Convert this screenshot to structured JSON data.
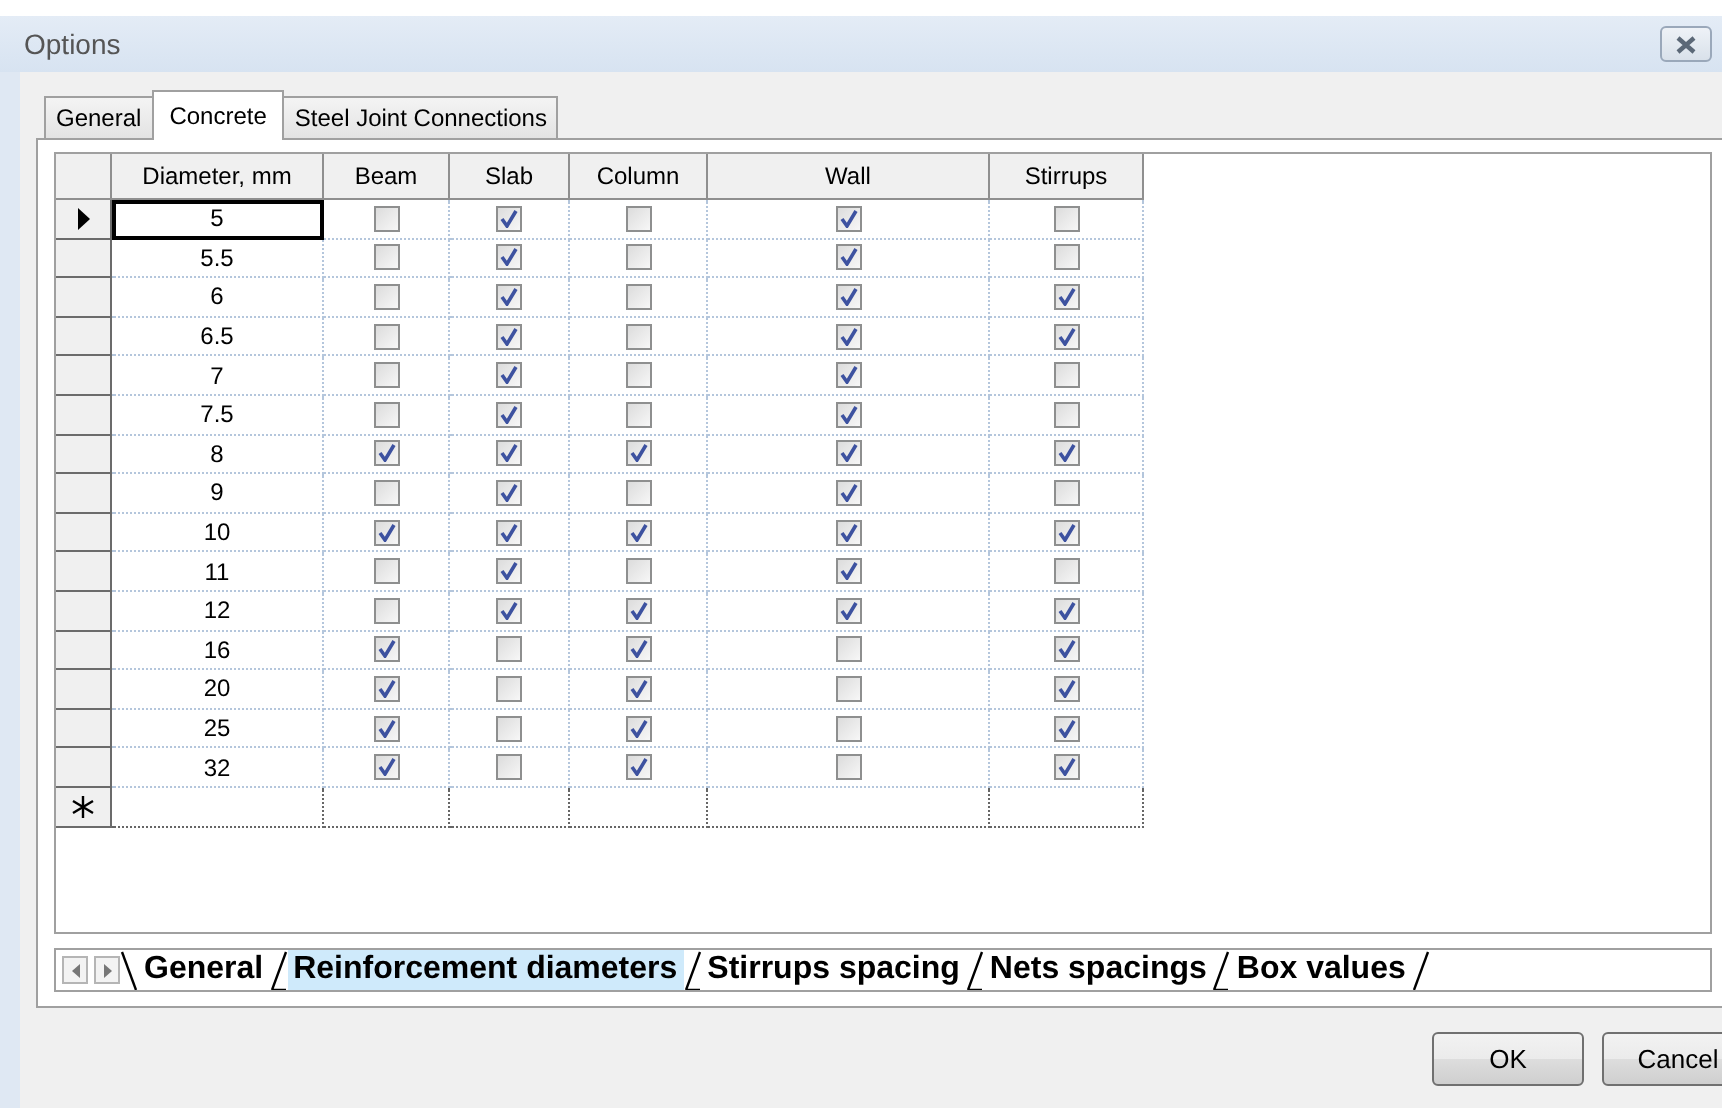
{
  "window": {
    "title": "Options"
  },
  "tabs": [
    {
      "label": "General",
      "selected": false
    },
    {
      "label": "Concrete",
      "selected": true
    },
    {
      "label": "Steel Joint Connections",
      "selected": false
    }
  ],
  "grid": {
    "columns": [
      "Diameter, mm",
      "Beam",
      "Slab",
      "Column",
      "Wall",
      "Stirrups"
    ],
    "rows": [
      {
        "diameter": "5",
        "selected": true,
        "checks": [
          false,
          true,
          false,
          true,
          false
        ]
      },
      {
        "diameter": "5.5",
        "selected": false,
        "checks": [
          false,
          true,
          false,
          true,
          false
        ]
      },
      {
        "diameter": "6",
        "selected": false,
        "checks": [
          false,
          true,
          false,
          true,
          true
        ]
      },
      {
        "diameter": "6.5",
        "selected": false,
        "checks": [
          false,
          true,
          false,
          true,
          true
        ]
      },
      {
        "diameter": "7",
        "selected": false,
        "checks": [
          false,
          true,
          false,
          true,
          false
        ]
      },
      {
        "diameter": "7.5",
        "selected": false,
        "checks": [
          false,
          true,
          false,
          true,
          false
        ]
      },
      {
        "diameter": "8",
        "selected": false,
        "checks": [
          true,
          true,
          true,
          true,
          true
        ]
      },
      {
        "diameter": "9",
        "selected": false,
        "checks": [
          false,
          true,
          false,
          true,
          false
        ]
      },
      {
        "diameter": "10",
        "selected": false,
        "checks": [
          true,
          true,
          true,
          true,
          true
        ]
      },
      {
        "diameter": "11",
        "selected": false,
        "checks": [
          false,
          true,
          false,
          true,
          false
        ]
      },
      {
        "diameter": "12",
        "selected": false,
        "checks": [
          false,
          true,
          true,
          true,
          true
        ]
      },
      {
        "diameter": "16",
        "selected": false,
        "checks": [
          true,
          false,
          true,
          false,
          true
        ]
      },
      {
        "diameter": "20",
        "selected": false,
        "checks": [
          true,
          false,
          true,
          false,
          true
        ]
      },
      {
        "diameter": "25",
        "selected": false,
        "checks": [
          true,
          false,
          true,
          false,
          true
        ]
      },
      {
        "diameter": "32",
        "selected": false,
        "checks": [
          true,
          false,
          true,
          false,
          true
        ]
      }
    ]
  },
  "sheet_tabs": [
    {
      "label": "General",
      "selected": false
    },
    {
      "label": "Reinforcement diameters",
      "selected": true
    },
    {
      "label": "Stirrups spacing",
      "selected": false
    },
    {
      "label": "Nets spacings",
      "selected": false
    },
    {
      "label": "Box values",
      "selected": false
    }
  ],
  "buttons": [
    "OK",
    "Cancel"
  ]
}
